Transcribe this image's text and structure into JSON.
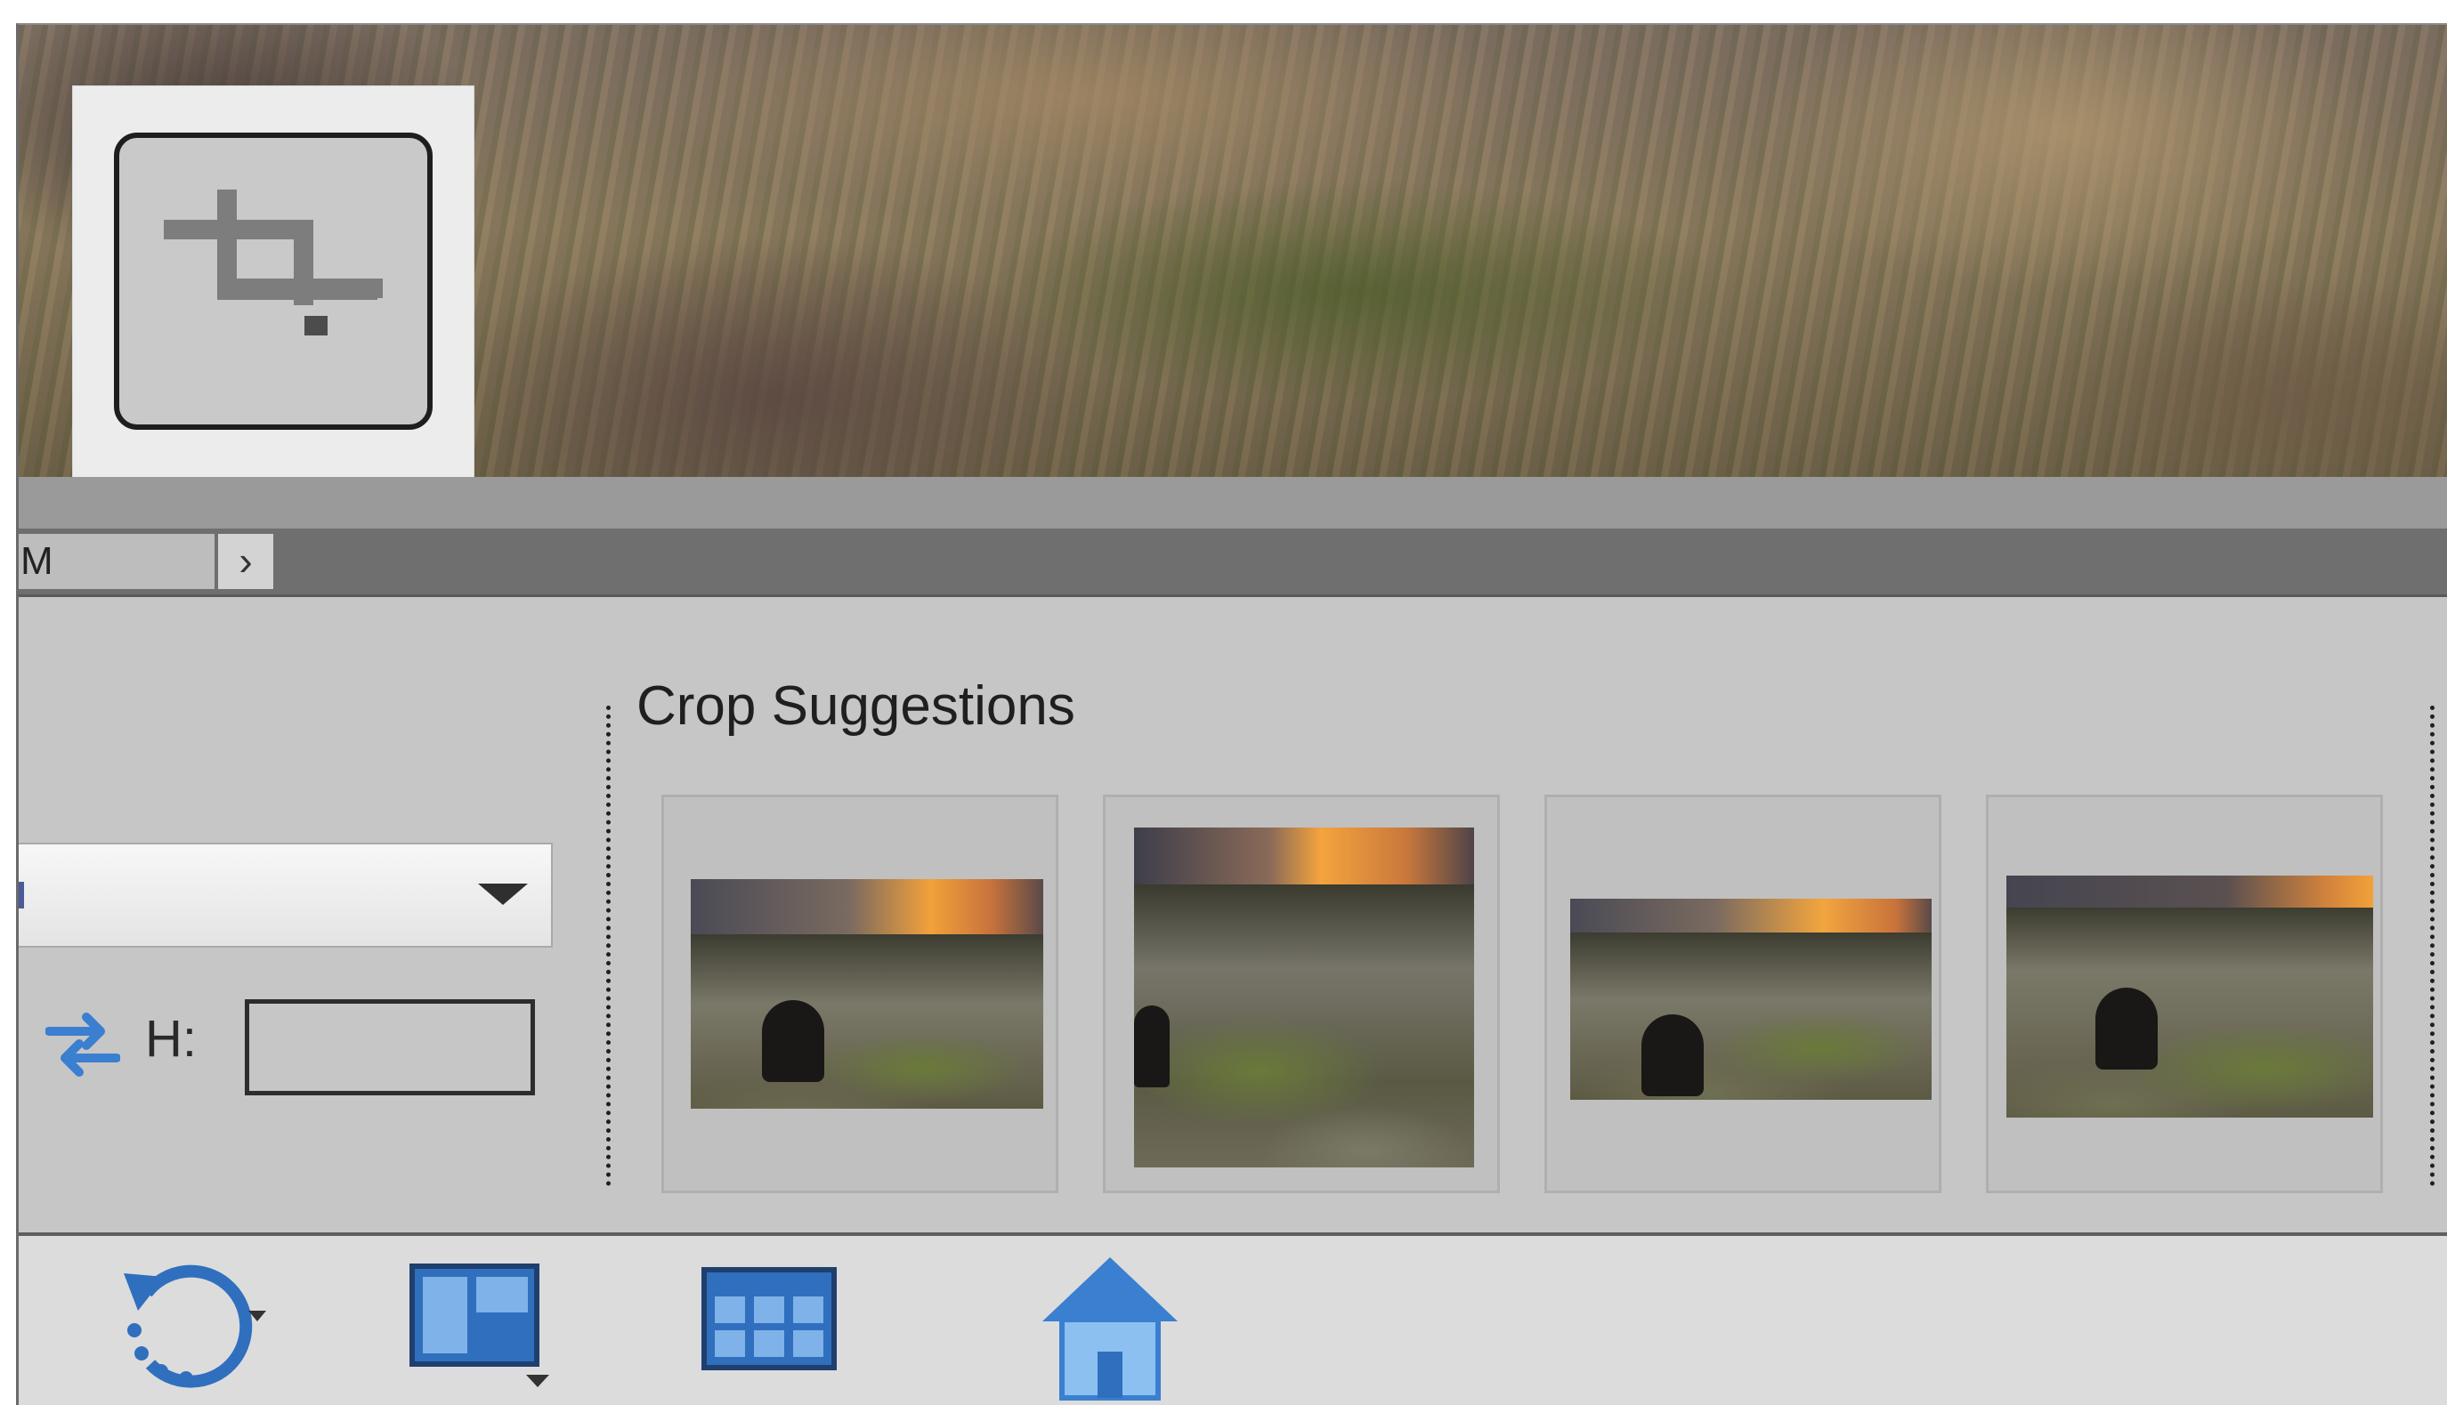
{
  "toolbar": {
    "crop_tool": {
      "icon": "crop-icon",
      "state": "selected"
    }
  },
  "navigation": {
    "field_text": "M",
    "next_arrow": "›"
  },
  "tool_options": {
    "dropdown": {
      "selected_value": "",
      "icon": "chevron-down-icon"
    },
    "swap_icon": "swap-arrows-icon",
    "height_label": "H:",
    "height_value": ""
  },
  "crop_suggestions": {
    "title": "Crop Suggestions",
    "items": [
      {
        "index": 1,
        "label": ""
      },
      {
        "index": 2,
        "label": ""
      },
      {
        "index": 3,
        "label": ""
      },
      {
        "index": 4,
        "label": ""
      }
    ]
  },
  "taskbar": {
    "buttons": [
      {
        "icon": "rotate-icon",
        "has_menu": true
      },
      {
        "icon": "layout-icon",
        "has_menu": true
      },
      {
        "icon": "organizer-grid-icon",
        "has_menu": false
      },
      {
        "icon": "home-icon",
        "has_menu": false
      }
    ]
  },
  "colors": {
    "panel": "#c6c6c6",
    "accent_blue": "#3a7fd0"
  }
}
